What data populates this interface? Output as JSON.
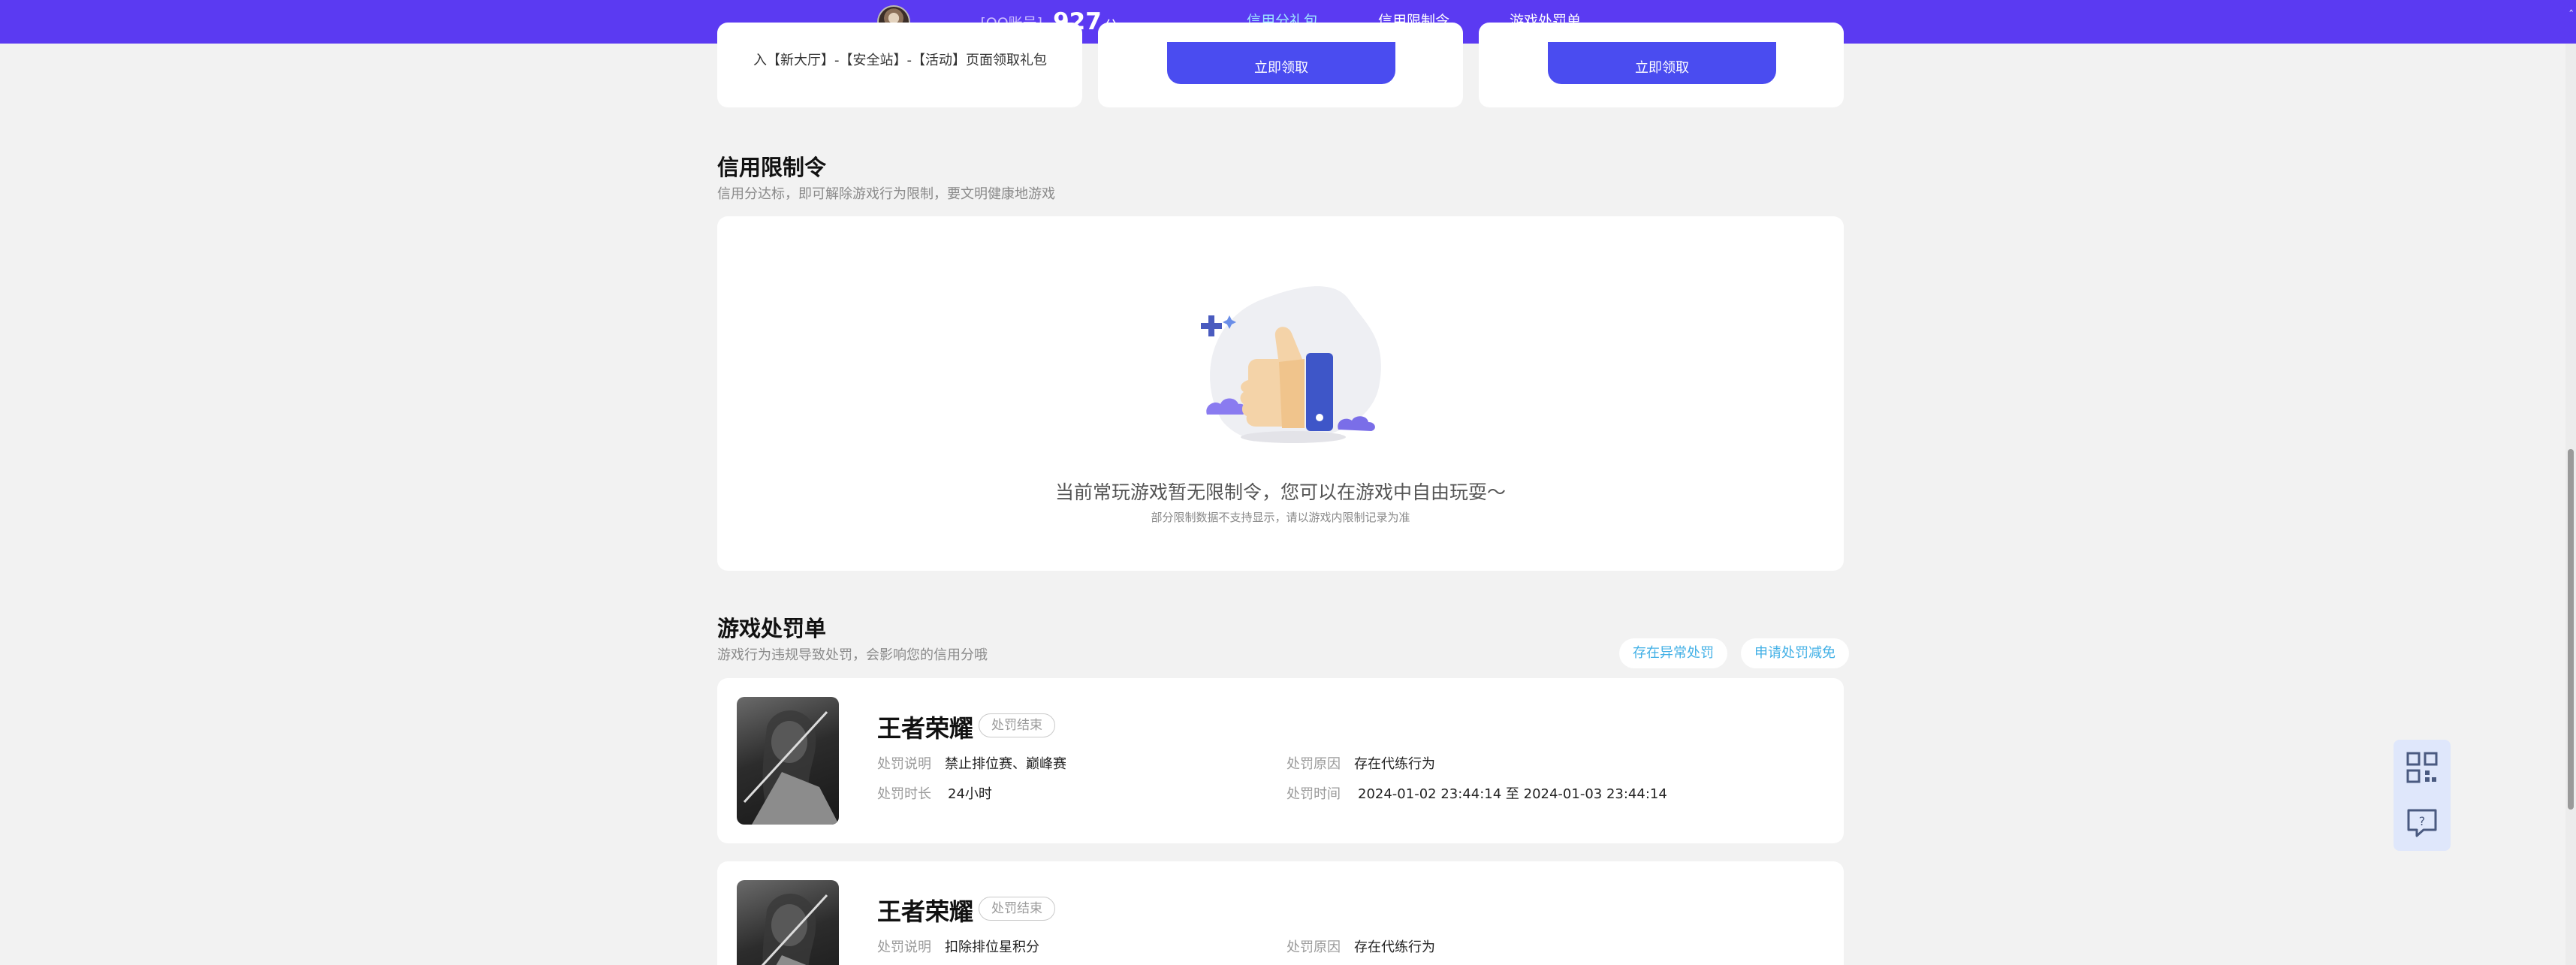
{
  "header": {
    "user_name": ". . .",
    "account_type": "[QQ账号]",
    "score": "927",
    "score_unit": "分",
    "corner_marker": "‸"
  },
  "nav": [
    {
      "label": "信用分礼包",
      "active": true
    },
    {
      "label": "信用限制令",
      "active": false
    },
    {
      "label": "游戏处罚单",
      "active": false
    }
  ],
  "gift_section": {
    "card1_text": "入【新大厅】-【安全站】-【活动】页面领取礼包",
    "claim_label": "立即领取"
  },
  "restriction": {
    "title": "信用限制令",
    "subtitle": "信用分达标，即可解除游戏行为限制，要文明健康地游戏",
    "empty_main": "当前常玩游戏暂无限制令，您可以在游戏中自由玩耍～",
    "empty_note": "部分限制数据不支持显示，请以游戏内限制记录为准"
  },
  "penalty": {
    "title": "游戏处罚单",
    "subtitle": "游戏行为违规导致处罚，会影响您的信用分哦",
    "btn_abnormal": "存在异常处罚",
    "btn_reduce": "申请处罚减免",
    "labels": {
      "desc": "处罚说明",
      "duration": "处罚时长",
      "reason": "处罚原因",
      "time": "处罚时间"
    },
    "items": [
      {
        "game": "王者荣耀",
        "status": "处罚结束",
        "desc": "禁止排位赛、巅峰赛",
        "duration": "24小时",
        "reason": "存在代练行为",
        "time": "2024-01-02 23:44:14 至 2024-01-03 23:44:14"
      },
      {
        "game": "王者荣耀",
        "status": "处罚结束",
        "desc": "扣除排位星积分",
        "reason": "存在代练行为"
      }
    ]
  },
  "colors": {
    "topbar": "#5b3af2",
    "active_nav": "#9ee8ff",
    "claim_button": "#4a4cf0",
    "pill_text": "#42b0e6"
  },
  "icons": {
    "float_top": "qr-code-icon",
    "float_bottom": "help-chat-icon"
  }
}
